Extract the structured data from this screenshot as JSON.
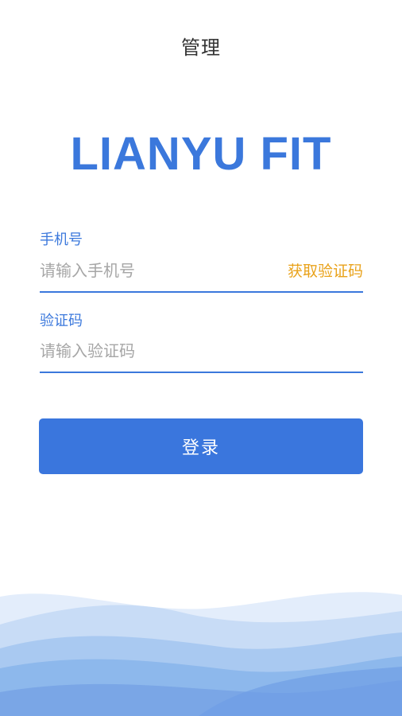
{
  "header": {
    "title": "管理"
  },
  "brand": {
    "name": "LIANYU FIT"
  },
  "phone": {
    "label": "手机号",
    "placeholder": "请输入手机号",
    "get_code_label": "获取验证码"
  },
  "code": {
    "label": "验证码",
    "placeholder": "请输入验证码"
  },
  "login": {
    "label": "登录"
  },
  "colors": {
    "accent": "#3b78dc",
    "button": "#3a76dd",
    "link": "#e9a21a",
    "placeholder": "#a6a6a6"
  }
}
